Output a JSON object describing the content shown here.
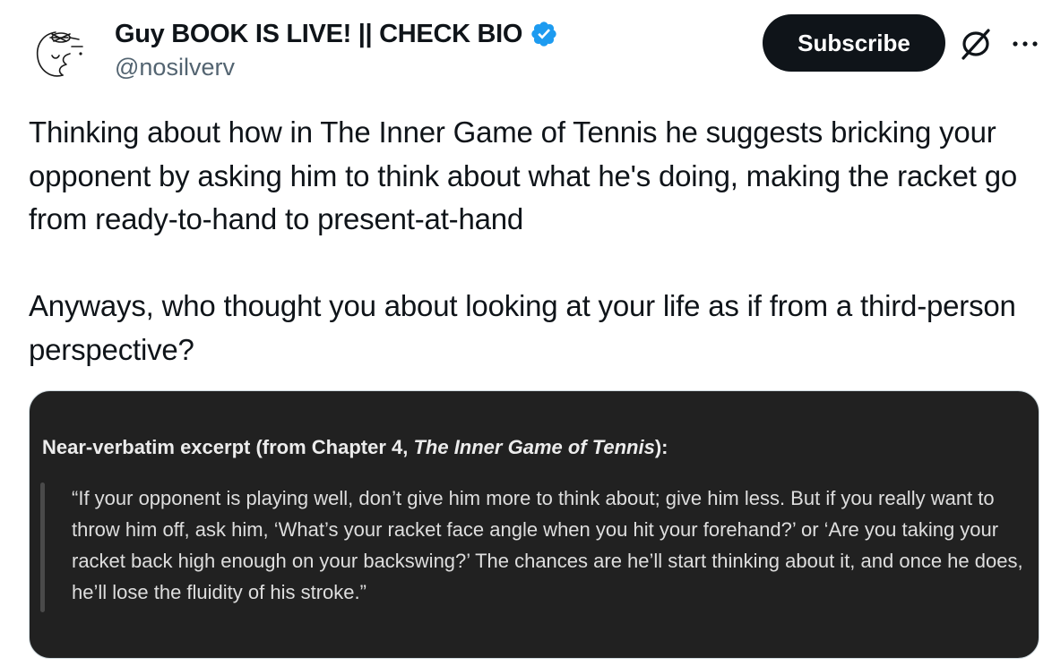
{
  "author": {
    "display_name": "Guy BOOK IS LIVE! || CHECK BIO",
    "handle": "@nosilverv",
    "verified": true,
    "verified_color": "#1d9bf0"
  },
  "actions": {
    "subscribe_label": "Subscribe",
    "grok_icon": "grok-icon",
    "more_icon": "more-options-icon"
  },
  "tweet": {
    "paragraph_1": "Thinking about how in The Inner Game of Tennis he suggests bricking your opponent by asking him to think about what he's doing, making the racket go from ready-to-hand to present-at-hand",
    "paragraph_2": "Anyways, who thought you about looking at your life as if from a third-person perspective?"
  },
  "media": {
    "heading_prefix": "Near-verbatim excerpt (from Chapter 4, ",
    "heading_title": "The Inner Game of Tennis",
    "heading_suffix": "):",
    "quote": "“If your opponent is playing well, don’t give him more to think about; give him less. But if you really want to throw him off, ask him, ‘What’s your racket face angle when you hit your forehand?’ or ‘Are you taking your racket back high enough on your backswing?’ The chances are he’ll start thinking about it, and once he does, he’ll lose the fluidity of his stroke.”",
    "background_color": "#212121"
  },
  "colors": {
    "text_primary": "#0f1419",
    "text_secondary": "#536471",
    "button_bg": "#0f1419"
  }
}
